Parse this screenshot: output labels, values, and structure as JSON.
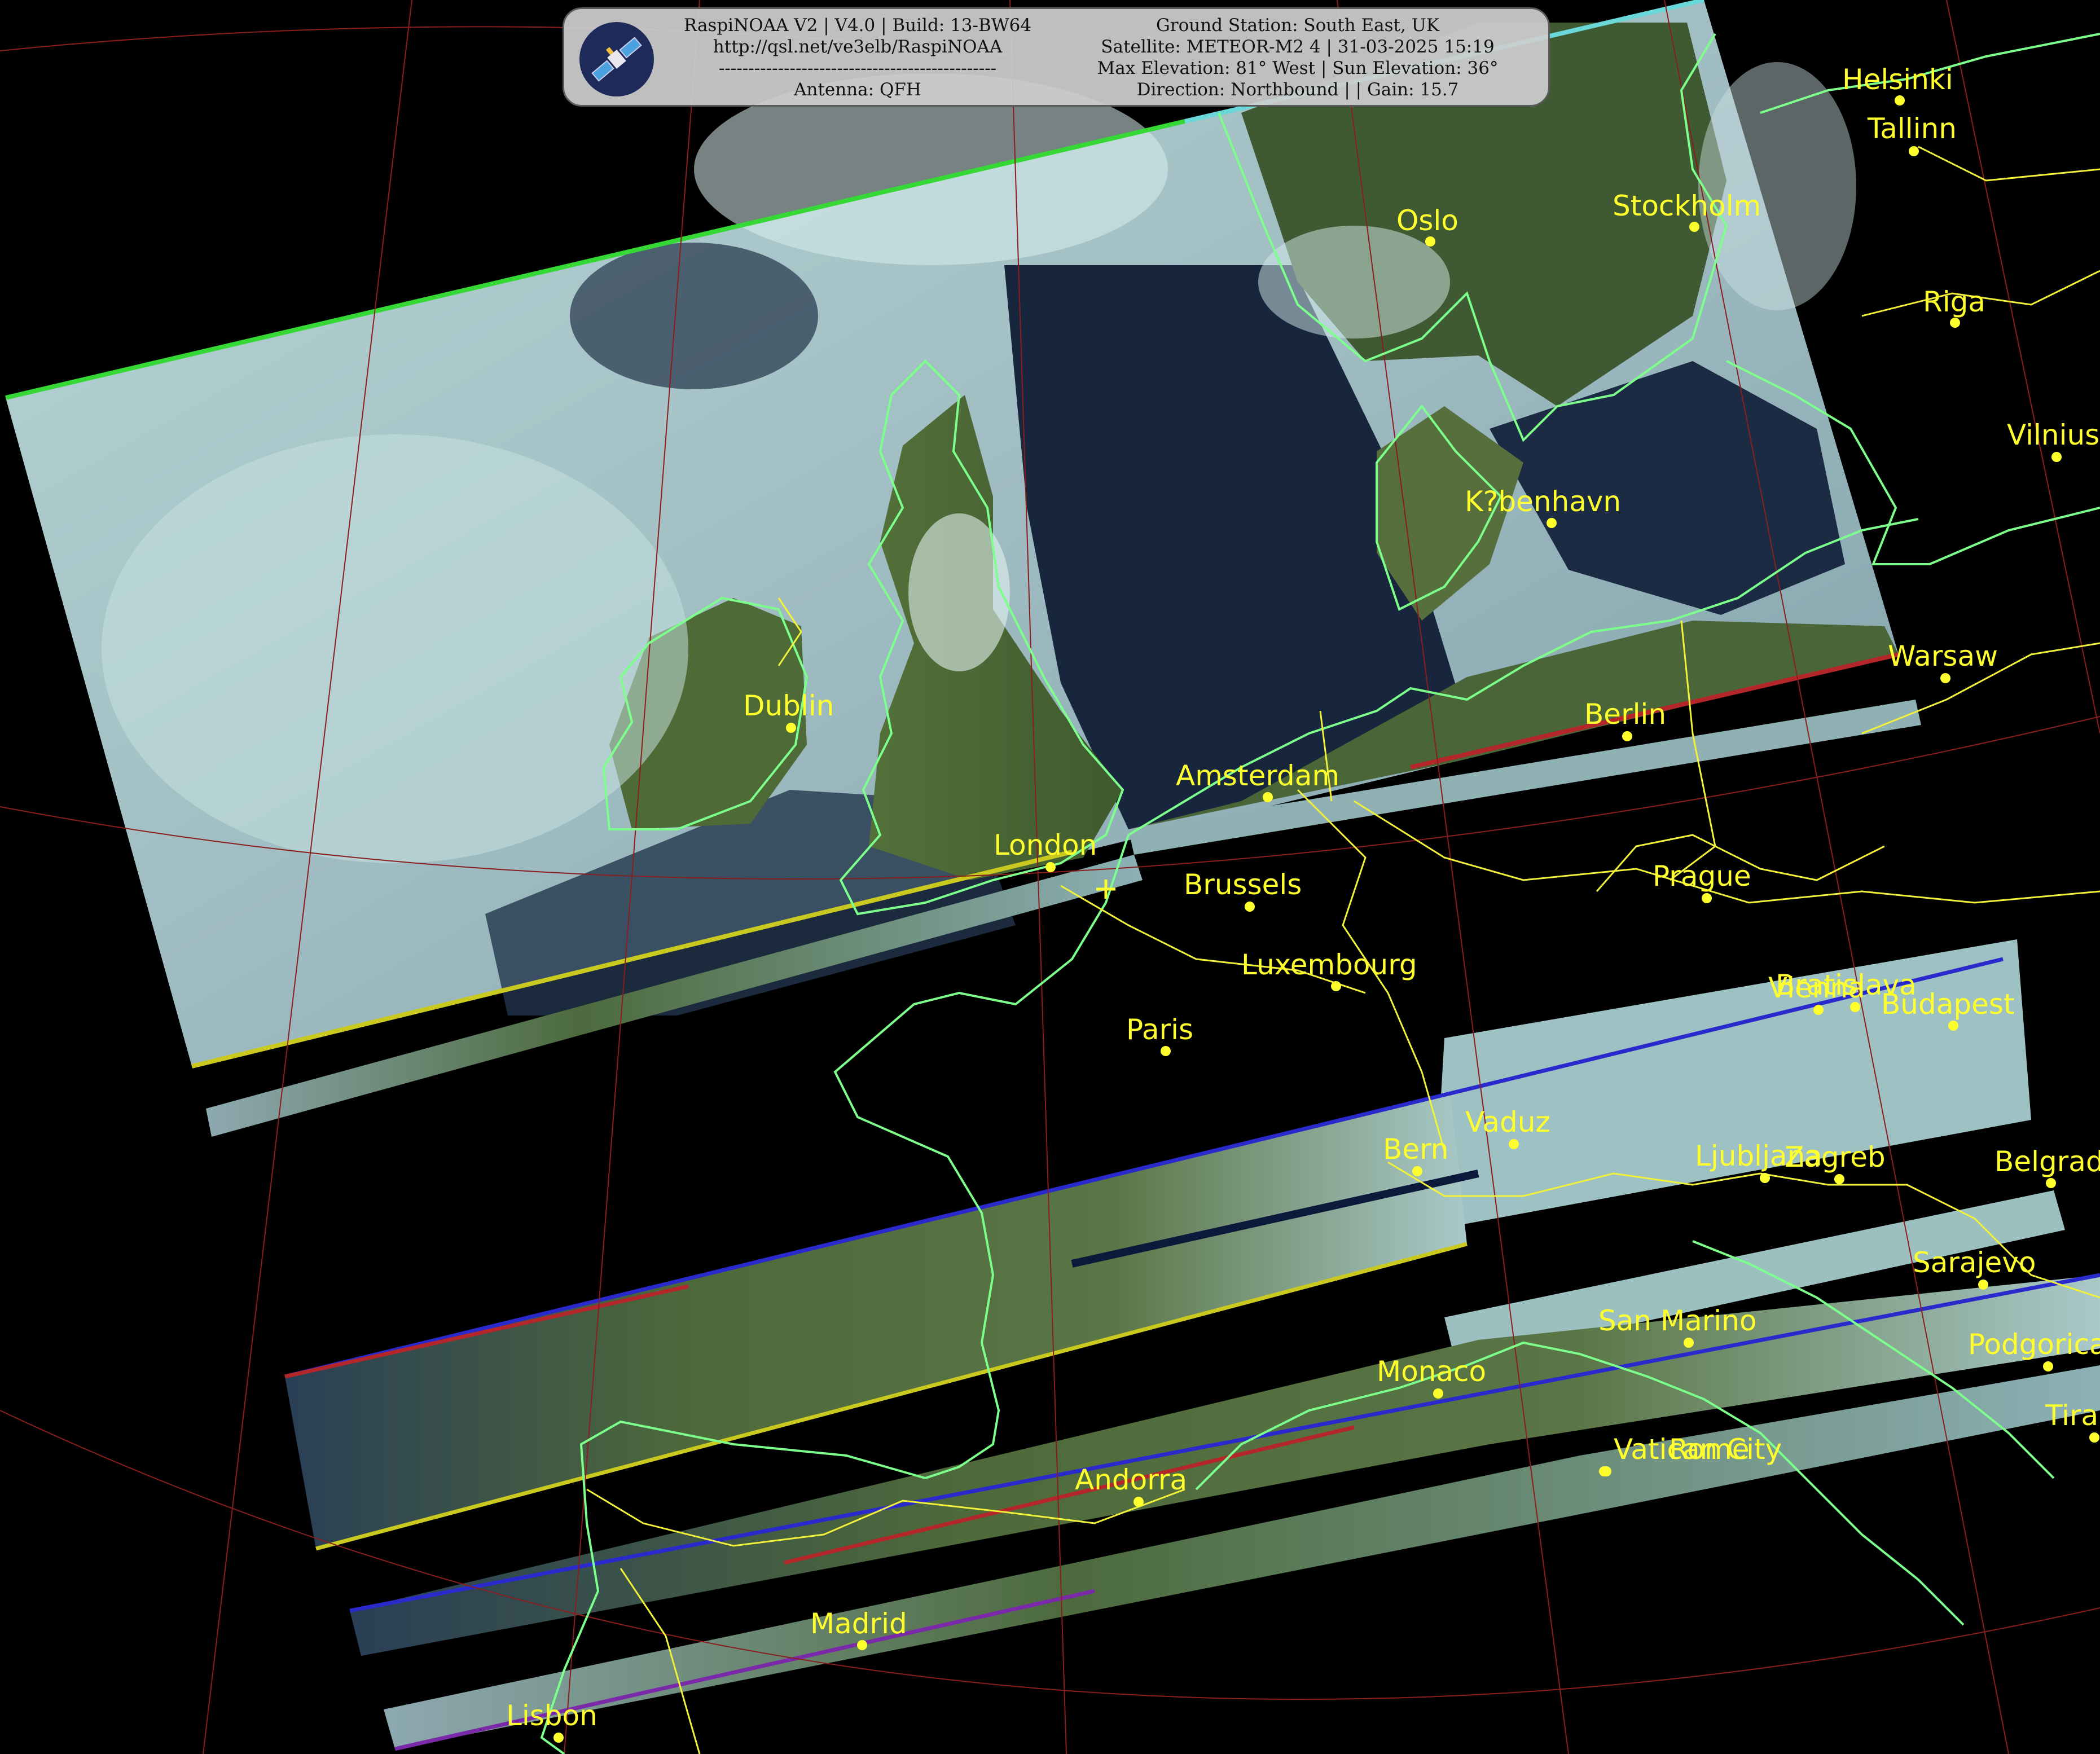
{
  "header": {
    "software": "RaspiNOAA V2 | V4.0 | Build: 13-BW64",
    "url": "http://qsl.net/ve3elb/RaspiNOAA",
    "separator": "-----------------------------------------------",
    "antenna": "Antenna: QFH",
    "ground_station": "Ground Station: South East, UK",
    "satellite": "Satellite: METEOR-M2 4 | 31-03-2025 15:19",
    "elevation": "Max Elevation: 81° West | Sun Elevation: 36°",
    "direction": "Direction: Northbound | | Gain: 15.7"
  },
  "logo": {
    "icon": "satellite-icon"
  },
  "station_marker": {
    "icon": "crosshair-icon"
  },
  "cities": [
    {
      "name": "Helsinki"
    },
    {
      "name": "Tallinn"
    },
    {
      "name": "Stockholm"
    },
    {
      "name": "Oslo"
    },
    {
      "name": "Riga"
    },
    {
      "name": "Vilnius"
    },
    {
      "name": "K?benhavn"
    },
    {
      "name": "Warsaw"
    },
    {
      "name": "Berlin"
    },
    {
      "name": "Dublin"
    },
    {
      "name": "Amsterdam"
    },
    {
      "name": "London"
    },
    {
      "name": "Brussels"
    },
    {
      "name": "Prague"
    },
    {
      "name": "Luxembourg"
    },
    {
      "name": "Paris"
    },
    {
      "name": "Bratislava"
    },
    {
      "name": "Vienna"
    },
    {
      "name": "Budapest"
    },
    {
      "name": "Vaduz"
    },
    {
      "name": "Bern"
    },
    {
      "name": "Ljubljana"
    },
    {
      "name": "Zagreb"
    },
    {
      "name": "Belgrade"
    },
    {
      "name": "Sarajevo"
    },
    {
      "name": "San Marino"
    },
    {
      "name": "Podgorica"
    },
    {
      "name": "Monaco"
    },
    {
      "name": "Tirana"
    },
    {
      "name": "Andorra"
    },
    {
      "name": "Vatican City"
    },
    {
      "name": "Rome"
    },
    {
      "name": "Madrid"
    },
    {
      "name": "Lisbon"
    }
  ],
  "colors": {
    "background": "#000000",
    "coastline": "#7dff8c",
    "border": "#f2f23a",
    "city": "#ffff2e",
    "graticule": "#8a1e1e",
    "cloud": "#c8e6e6",
    "sea": "#16243a",
    "land": "#4f6a36"
  }
}
